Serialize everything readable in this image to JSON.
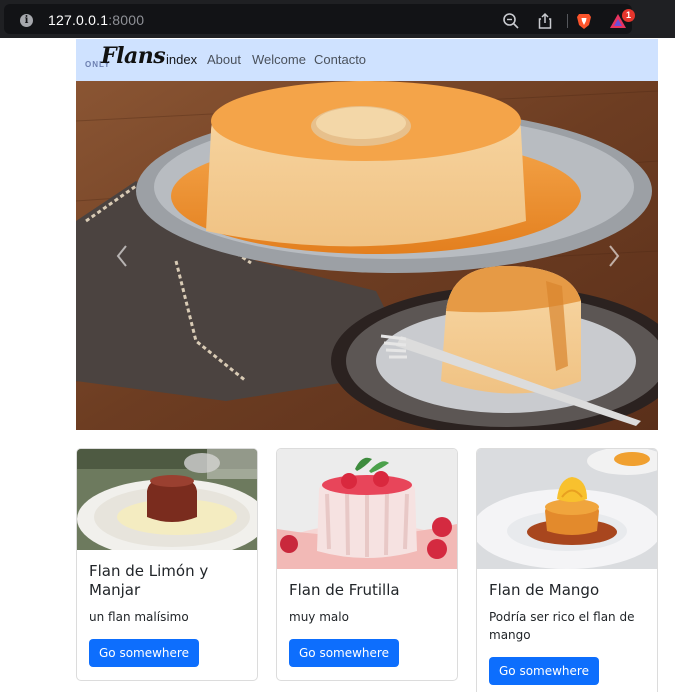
{
  "browser": {
    "url_host": "127.0.0.1",
    "url_port": ":8000",
    "notification_count": "1",
    "icons": [
      "info-icon",
      "zoom-icon",
      "share-icon",
      "brave-shield-icon",
      "brave-rewards-icon"
    ]
  },
  "navbar": {
    "brand_small": "ONLY",
    "brand_script": "Flans",
    "items": [
      {
        "label": "index"
      },
      {
        "label": "About"
      },
      {
        "label": "Welcome"
      },
      {
        "label": "Contacto"
      }
    ],
    "background": "#cfe2ff"
  },
  "carousel": {
    "prev_icon": "chevron-left-icon",
    "next_icon": "chevron-right-icon"
  },
  "cards": [
    {
      "title": "Flan de Limón y Manjar",
      "text": "un flan malísimo",
      "button": "Go somewhere"
    },
    {
      "title": "Flan de Frutilla",
      "text": "muy malo",
      "button": "Go somewhere"
    },
    {
      "title": "Flan de Mango",
      "text": "Podría ser rico el flan de mango",
      "button": "Go somewhere"
    }
  ],
  "colors": {
    "primary": "#0d6efd",
    "chrome_bg": "#1f2023"
  }
}
